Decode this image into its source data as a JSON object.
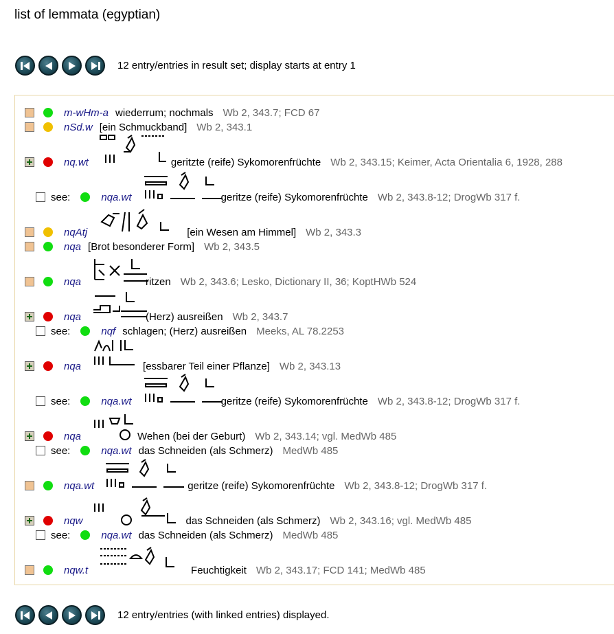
{
  "page": {
    "title": "list of lemmata (egyptian)",
    "result_text_top": "12 entry/entries in result set; display starts at entry 1",
    "result_text_bottom": "12 entry/entries (with linked entries) displayed."
  },
  "nav": {
    "icons": [
      "first-icon",
      "previous-icon",
      "next-icon",
      "last-icon"
    ]
  },
  "colors": {
    "status_green": "#11dd11",
    "status_yellow": "#f0c000",
    "status_red": "#e00000",
    "transliteration": "#1a1a88",
    "reference": "#666666",
    "box_border": "#e8d6a6"
  },
  "entries": [
    {
      "see": "",
      "translit": "m-wHm-a",
      "gloss": "wiederrum; nochmals",
      "ref": "Wb 2, 343.7; FCD 67"
    },
    {
      "see": "",
      "translit": "nSd.w",
      "gloss": "[ein Schmuckband]",
      "ref": "Wb 2, 343.1"
    },
    {
      "see": "",
      "translit": "nq.wt",
      "gloss": "geritzte (reife) Sykomorenfrüchte",
      "ref": "Wb 2, 343.15; Keimer, Acta Orientalia 6, 1928, 288"
    },
    {
      "see": "see:",
      "translit": "nqa.wt",
      "gloss": "geritze (reife) Sykomorenfrüchte",
      "ref": "Wb 2, 343.8-12; DrogWb 317 f."
    },
    {
      "see": "",
      "translit": "nqAtj",
      "gloss": "[ein Wesen am Himmel]",
      "ref": "Wb 2, 343.3"
    },
    {
      "see": "",
      "translit": "nqa",
      "gloss": "[Brot besonderer Form]",
      "ref": "Wb 2, 343.5"
    },
    {
      "see": "",
      "translit": "nqa",
      "gloss": "ritzen",
      "ref": "Wb 2, 343.6; Lesko, Dictionary II, 36; KoptHWb 524"
    },
    {
      "see": "",
      "translit": "nqa",
      "gloss": "(Herz) ausreißen",
      "ref": "Wb 2, 343.7"
    },
    {
      "see": "see:",
      "translit": "nqf",
      "gloss": "schlagen; (Herz) ausreißen",
      "ref": "Meeks, AL 78.2253"
    },
    {
      "see": "",
      "translit": "nqa",
      "gloss": "[essbarer Teil einer Pflanze]",
      "ref": "Wb 2, 343.13"
    },
    {
      "see": "see:",
      "translit": "nqa.wt",
      "gloss": "geritze (reife) Sykomorenfrüchte",
      "ref": "Wb 2, 343.8-12; DrogWb 317 f."
    },
    {
      "see": "",
      "translit": "nqa",
      "gloss": "Wehen (bei der Geburt)",
      "ref": "Wb 2, 343.14; vgl. MedWb 485"
    },
    {
      "see": "see:",
      "translit": "nqa.wt",
      "gloss": "das Schneiden (als Schmerz)",
      "ref": "MedWb 485"
    },
    {
      "see": "",
      "translit": "nqa.wt",
      "gloss": "geritze (reife) Sykomorenfrüchte",
      "ref": "Wb 2, 343.8-12; DrogWb 317 f."
    },
    {
      "see": "",
      "translit": "nqw",
      "gloss": "das Schneiden (als Schmerz)",
      "ref": "Wb 2, 343.16; vgl. MedWb 485"
    },
    {
      "see": "see:",
      "translit": "nqa.wt",
      "gloss": "das Schneiden (als Schmerz)",
      "ref": "MedWb 485"
    },
    {
      "see": "",
      "translit": "nqw.t",
      "gloss": "Feuchtigkeit",
      "ref": "Wb 2, 343.17; FCD 141; MedWb 485"
    }
  ]
}
